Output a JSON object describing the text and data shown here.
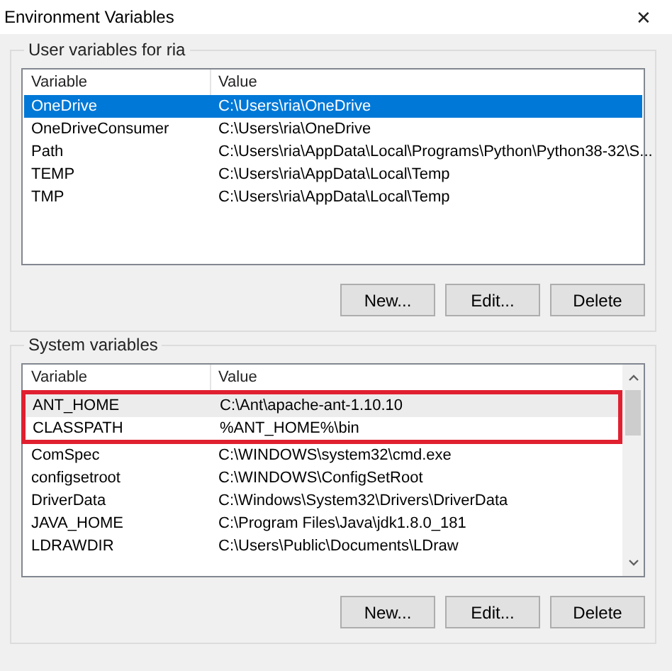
{
  "window": {
    "title": "Environment Variables",
    "close": "✕"
  },
  "groups": [
    {
      "title": "User variables for ria",
      "focused": true,
      "scrollbar": false,
      "columns": [
        "Variable",
        "Value"
      ],
      "rows": [
        {
          "name": "OneDrive",
          "value": "C:\\Users\\ria\\OneDrive",
          "selected": true,
          "boxed": false
        },
        {
          "name": "OneDriveConsumer",
          "value": "C:\\Users\\ria\\OneDrive",
          "selected": false,
          "boxed": false
        },
        {
          "name": "Path",
          "value": "C:\\Users\\ria\\AppData\\Local\\Programs\\Python\\Python38-32\\S...",
          "selected": false,
          "boxed": false
        },
        {
          "name": "TEMP",
          "value": "C:\\Users\\ria\\AppData\\Local\\Temp",
          "selected": false,
          "boxed": false
        },
        {
          "name": "TMP",
          "value": "C:\\Users\\ria\\AppData\\Local\\Temp",
          "selected": false,
          "boxed": false
        }
      ],
      "buttons": [
        "New...",
        "Edit...",
        "Delete"
      ]
    },
    {
      "title": "System variables",
      "focused": false,
      "scrollbar": true,
      "columns": [
        "Variable",
        "Value"
      ],
      "rows": [
        {
          "name": "ANT_HOME",
          "value": "C:\\Ant\\apache-ant-1.10.10",
          "selected": true,
          "boxed": true
        },
        {
          "name": "CLASSPATH",
          "value": "%ANT_HOME%\\bin",
          "selected": false,
          "boxed": true
        },
        {
          "name": "ComSpec",
          "value": "C:\\WINDOWS\\system32\\cmd.exe",
          "selected": false,
          "boxed": false
        },
        {
          "name": "configsetroot",
          "value": "C:\\WINDOWS\\ConfigSetRoot",
          "selected": false,
          "boxed": false
        },
        {
          "name": "DriverData",
          "value": "C:\\Windows\\System32\\Drivers\\DriverData",
          "selected": false,
          "boxed": false
        },
        {
          "name": "JAVA_HOME",
          "value": "C:\\Program Files\\Java\\jdk1.8.0_181",
          "selected": false,
          "boxed": false
        },
        {
          "name": "LDRAWDIR",
          "value": "C:\\Users\\Public\\Documents\\LDraw",
          "selected": false,
          "boxed": false
        }
      ],
      "buttons": [
        "New...",
        "Edit...",
        "Delete"
      ]
    }
  ]
}
